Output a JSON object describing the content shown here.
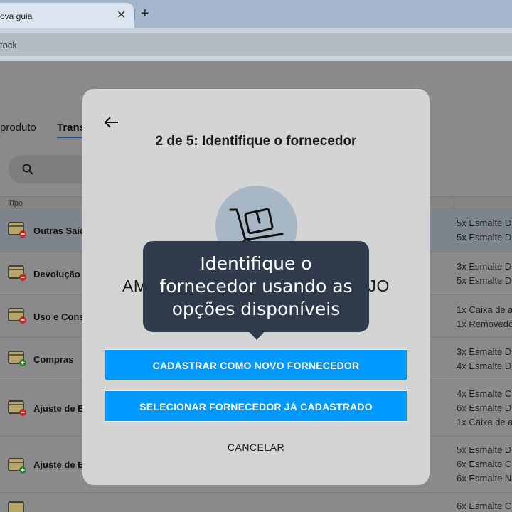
{
  "browser": {
    "tab_title": "ova guia",
    "new_tab_symbol": "+",
    "close_symbol": "✕",
    "address_text": "tock"
  },
  "page": {
    "tabs": [
      "produto",
      "Trans"
    ],
    "table_header": {
      "tipo": "Tipo"
    },
    "rows": [
      {
        "label": "Outras Saíd",
        "status": "minus",
        "items": [
          "5x Esmalte D",
          "5x Esmalte D"
        ]
      },
      {
        "label": "Devolução",
        "status": "minus",
        "items": [
          "3x Esmalte D",
          "5x Esmalte D"
        ]
      },
      {
        "label": "Uso e Cons",
        "status": "minus",
        "items": [
          "1x Caixa de a",
          "1x Removedo"
        ]
      },
      {
        "label": "Compras",
        "status": "plus",
        "items": [
          "3x Esmalte D",
          "4x Esmalte D"
        ]
      },
      {
        "label": "Ajuste de E",
        "status": "minus",
        "items": [
          "4x Esmalte C",
          "6x Esmalte D",
          "1x Caixa de a"
        ]
      },
      {
        "label": "Ajuste de E",
        "status": "plus",
        "items": [
          "5x Esmalte D",
          "6x Esmalte C",
          "6x Esmalte N"
        ]
      },
      {
        "label": "",
        "status": "minus",
        "items": [
          "6x Esmalte C"
        ]
      }
    ]
  },
  "modal": {
    "title": "2 de 5: Identifique o fornecedor",
    "partial_label_left": "AM",
    "partial_label_right": "JO",
    "primary_button": "CADASTRAR COMO NOVO FORNECEDOR",
    "secondary_button": "SELECIONAR FORNECEDOR JÁ CADASTRADO",
    "cancel": "CANCELAR"
  },
  "tooltip": {
    "lines": [
      "Identifique o",
      "fornecedor usando as",
      "opções disponíveis"
    ]
  },
  "colors": {
    "primary_button": "#0099ff",
    "tooltip_bg": "#2f3b4a",
    "illustration_bg": "#a8b7c6",
    "status_minus": "#c62828",
    "status_plus": "#2e7d32"
  }
}
